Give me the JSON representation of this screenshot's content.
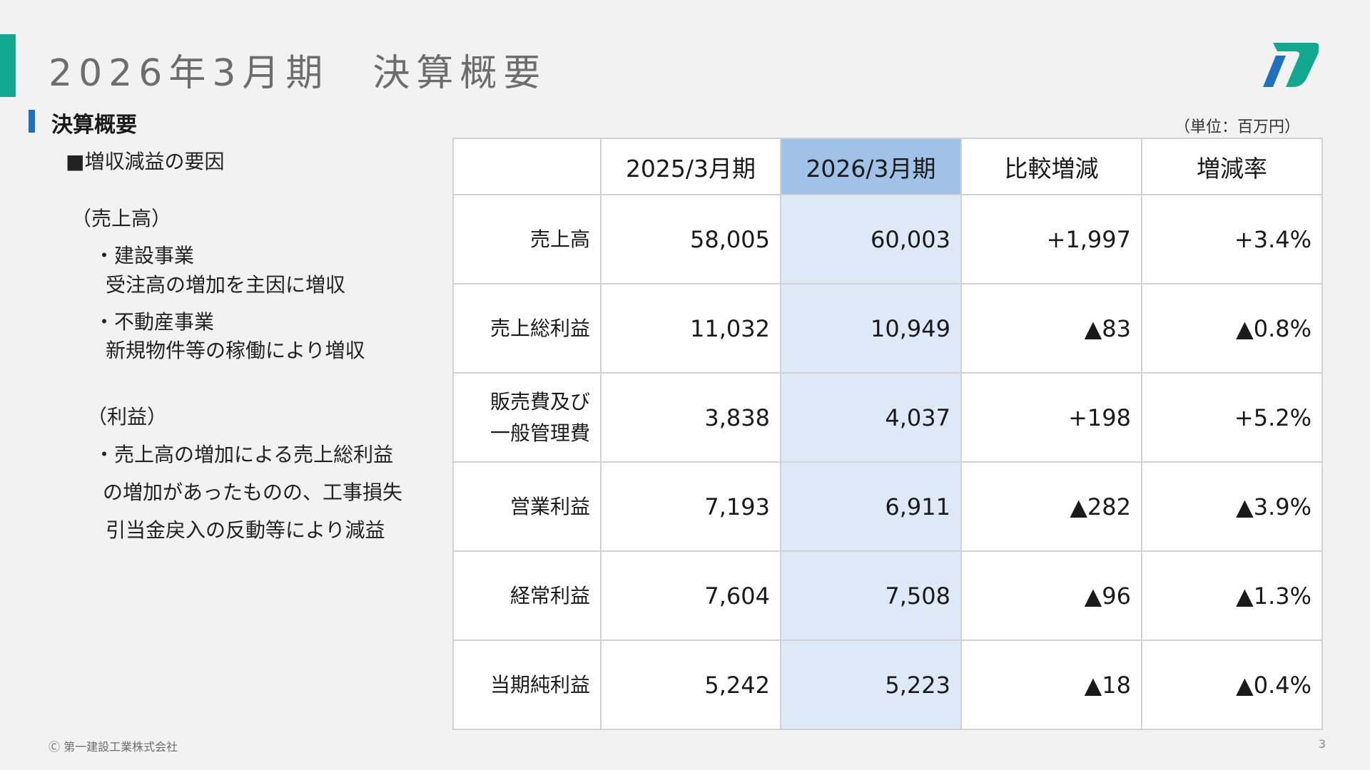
{
  "header": {
    "title": "2026年3月期　決算概要",
    "logo_icon": "company-logo-icon",
    "accent_color": "#12a88f"
  },
  "section": {
    "title": "決算概要",
    "unit_note": "（単位：百万円）"
  },
  "left_panel": {
    "heading": "■増収減益の要因",
    "sales_heading": "（売上高）",
    "sales_items": [
      {
        "title": "・建設事業",
        "detail": "受注高の増加を主因に増収"
      },
      {
        "title": "・不動産事業",
        "detail": "新規物件等の稼働により増収"
      }
    ],
    "profit_heading": "（利益）",
    "profit_lines": [
      "・売上高の増加による売上総利益",
      "の増加があったものの、工事損失",
      "引当金戻入の反動等により減益"
    ]
  },
  "table": {
    "headers": [
      "",
      "2025/3月期",
      "2026/3月期",
      "比較増減",
      "増減率"
    ],
    "rows": [
      {
        "label": "売上高",
        "values": [
          "58,005",
          "60,003",
          "+1,997",
          "+3.4%"
        ]
      },
      {
        "label_lines": [
          "販売費及び",
          "一般管理費"
        ],
        "label": "",
        "values": [],
        "skip": true
      },
      {
        "label": "売上総利益",
        "values": [
          "11,032",
          "10,949",
          "▲83",
          "▲0.8%"
        ]
      },
      {
        "label": "営業利益",
        "values": [
          "7,193",
          "6,911",
          "▲282",
          "▲3.9%"
        ]
      },
      {
        "label": "経常利益",
        "values": [
          "7,604",
          "7,508",
          "▲96",
          "▲1.3%"
        ]
      },
      {
        "label": "当期純利益",
        "values": [
          "5,242",
          "5,223",
          "▲18",
          "▲0.4%"
        ]
      }
    ],
    "sga": {
      "label_line1": "販売費及び",
      "label_line2": "一般管理費",
      "values": [
        "3,838",
        "4,037",
        "+198",
        "+5.2%"
      ]
    },
    "highlight_header_color": "#9fc2e6",
    "highlight_cell_color": "#dde9f6"
  },
  "footer": {
    "copyright": "Ⓒ 第一建設工業株式会社",
    "page_number": "3"
  }
}
